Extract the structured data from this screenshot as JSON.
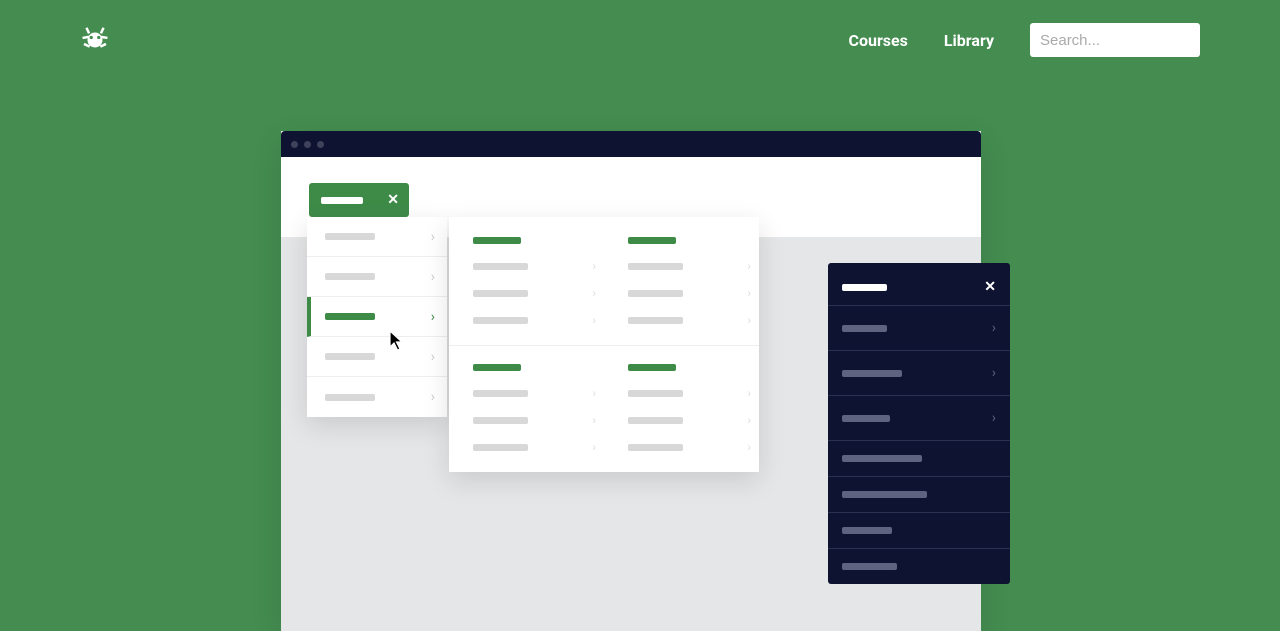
{
  "header": {
    "nav": {
      "courses": "Courses",
      "library": "Library"
    },
    "search": {
      "placeholder": "Search..."
    }
  },
  "colors": {
    "background": "#448c50",
    "accent": "#3e8b48",
    "dark": "#0d1330"
  }
}
